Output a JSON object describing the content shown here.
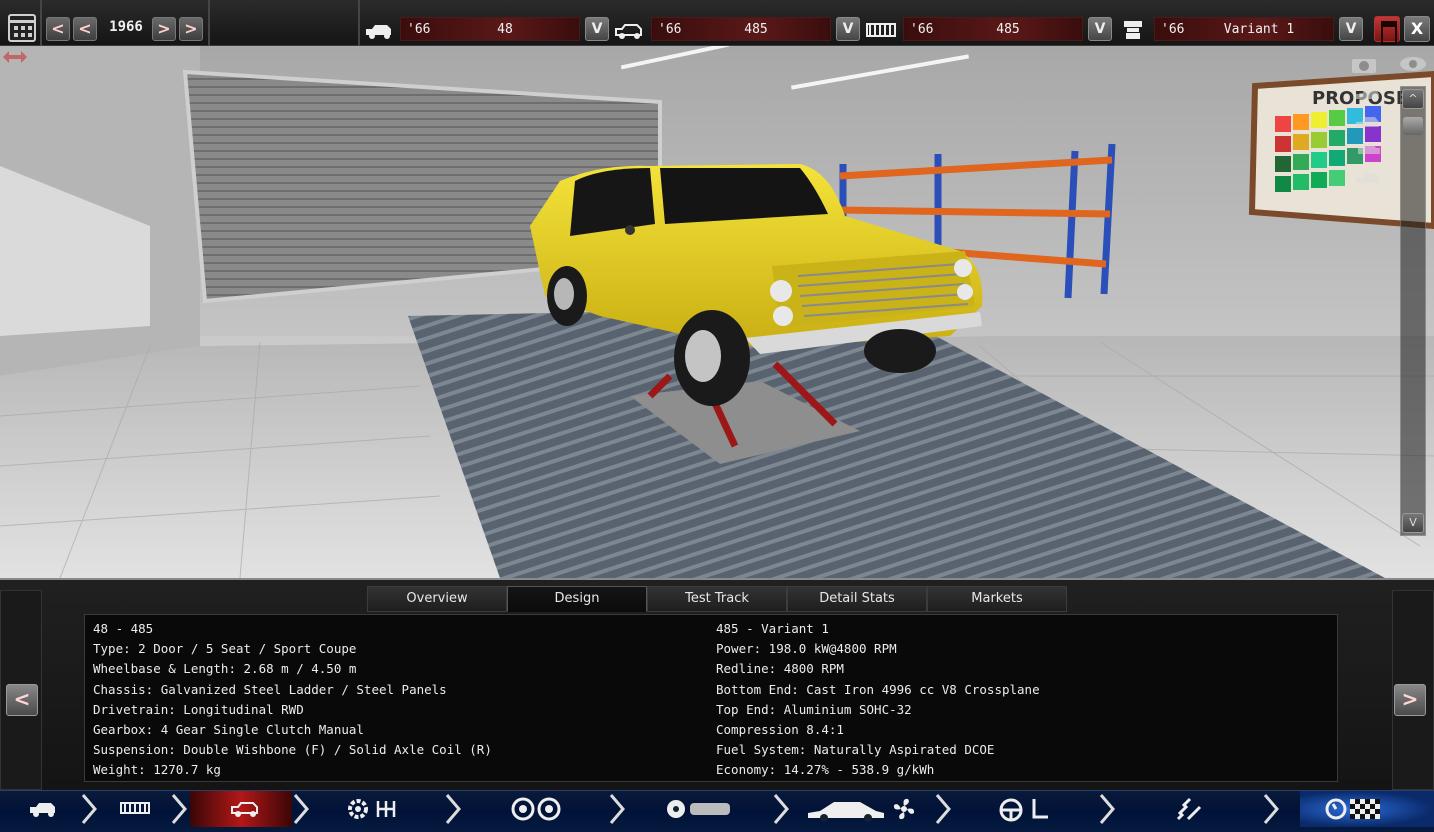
{
  "topbar": {
    "year": "1966",
    "year_prev_label": "<",
    "year_prev2_label": "<",
    "year_next_label": ">",
    "year_next2_label": ">",
    "selectors": [
      {
        "icon": "car-model-icon",
        "year": "'66",
        "name": "48",
        "dropdown": "V"
      },
      {
        "icon": "car-trim-icon",
        "year": "'66",
        "name": "485",
        "dropdown": "V"
      },
      {
        "icon": "engine-family-icon",
        "year": "'66",
        "name": "485",
        "dropdown": "V"
      },
      {
        "icon": "engine-variant-icon",
        "year": "'66",
        "name": "Variant 1",
        "dropdown": "V"
      }
    ],
    "save_icon": "save-icon",
    "close_label": "X"
  },
  "viewport": {
    "poster_text": "PROPOSE",
    "scroll_up": "^",
    "scroll_down": "V",
    "colors": {
      "car": "#e6d21e",
      "floor": "#c9c9c9",
      "rack_orange": "#e0651e",
      "rack_blue": "#2a4fb8"
    }
  },
  "panel": {
    "tabs": [
      {
        "label": "Overview",
        "active": false
      },
      {
        "label": "Design",
        "active": true
      },
      {
        "label": "Test Track",
        "active": false
      },
      {
        "label": "Detail Stats",
        "active": false
      },
      {
        "label": "Markets",
        "active": false
      }
    ],
    "left_stats": [
      "48 - 485",
      "Type: 2 Door / 5 Seat / Sport Coupe",
      "Wheelbase & Length: 2.68 m / 4.50 m",
      "Chassis: Galvanized Steel Ladder / Steel Panels",
      "Drivetrain: Longitudinal RWD",
      "Gearbox: 4 Gear Single Clutch Manual",
      "Suspension: Double Wishbone (F) / Solid Axle Coil (R)",
      "Weight: 1270.7 kg"
    ],
    "right_stats": [
      "485 - Variant 1",
      "Power: 198.0 kW@4800 RPM",
      "Redline: 4800 RPM",
      "Bottom End: Cast Iron 4996 cc V8 Crossplane",
      "Top End: Aluminium SOHC-32",
      "Compression 8.4:1",
      "Fuel System: Naturally Aspirated DCOE",
      "Economy: 14.27% - 538.9 g/kWh"
    ],
    "prev_label": "<",
    "next_label": ">"
  },
  "bottomnav": {
    "steps": [
      {
        "name": "model-step",
        "icons": [
          "car-silhouette-icon"
        ],
        "active": false
      },
      {
        "name": "chassis-step",
        "icons": [
          "chassis-frame-icon"
        ],
        "active": false
      },
      {
        "name": "trim-step",
        "icons": [
          "car-trim-icon"
        ],
        "active": true
      },
      {
        "name": "drivetrain-step",
        "icons": [
          "gear-icon",
          "gearbox-icon"
        ],
        "active": false
      },
      {
        "name": "wheels-step",
        "icons": [
          "wheel-icon",
          "wheel-icon"
        ],
        "active": false
      },
      {
        "name": "engine-step",
        "icons": [
          "engine-icon"
        ],
        "active": false
      },
      {
        "name": "body-step",
        "icons": [
          "car-body-icon",
          "fan-icon"
        ],
        "active": false
      },
      {
        "name": "interior-step",
        "icons": [
          "steering-wheel-icon",
          "seat-icon"
        ],
        "active": false
      },
      {
        "name": "suspension-step",
        "icons": [
          "spring-icon"
        ],
        "active": false
      },
      {
        "name": "testing-step",
        "icons": [
          "gauge-icon",
          "checkered-flag-icon"
        ],
        "active": false
      }
    ]
  }
}
